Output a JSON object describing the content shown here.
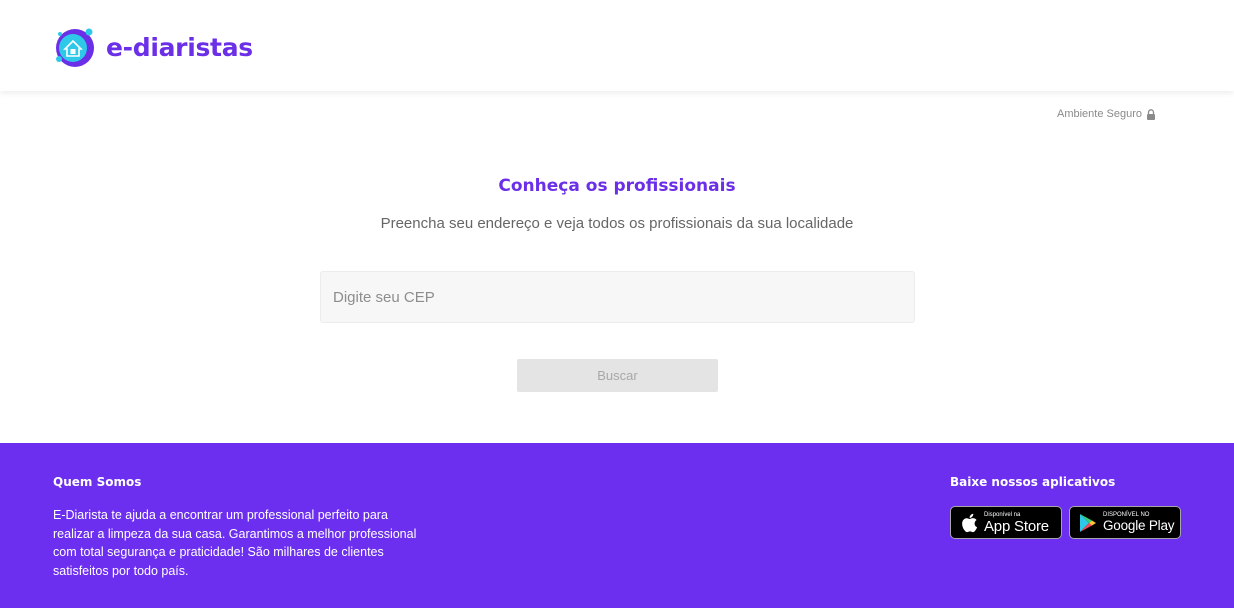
{
  "header": {
    "brand": "e-diaristas",
    "colors": {
      "brand": "#6b2fe8",
      "accent": "#2ec9e8"
    }
  },
  "secure": {
    "label": "Ambiente Seguro",
    "icon": "lock-icon"
  },
  "main": {
    "title": "Conheça os profissionais",
    "subtitle": "Preencha seu endereço e veja todos os profissionais da sua localidade",
    "cep_placeholder": "Digite seu CEP",
    "search_label": "Buscar"
  },
  "footer": {
    "background": "#6c2ff0",
    "about_title": "Quem Somos",
    "about_text": "E-Diarista te ajuda a encontrar um professional perfeito para realizar a limpeza da sua casa. Garantimos a melhor professional com total segurança e praticidade! São milhares de clientes satisfeitos por todo país.",
    "apps_title": "Baixe nossos aplicativos",
    "appstore": {
      "small": "Disponível na",
      "big": "App Store",
      "icon": "apple-icon"
    },
    "googleplay": {
      "small": "DISPONÍVEL NO",
      "big": "Google Play",
      "icon": "google-play-icon"
    }
  }
}
